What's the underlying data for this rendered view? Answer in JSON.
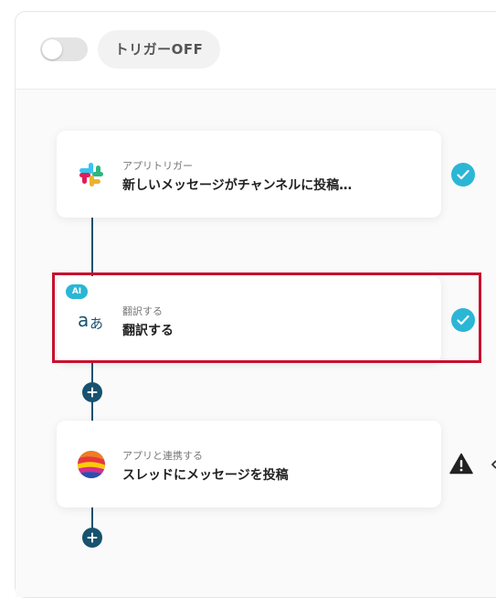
{
  "header": {
    "toggle_state": "off",
    "trigger_label": "トリガーOFF"
  },
  "flow": {
    "steps": [
      {
        "subtitle": "アプリトリガー",
        "title": "新しいメッセージがチャンネルに投稿…",
        "icon": "slack-icon",
        "status": "complete"
      },
      {
        "badge": "AI",
        "subtitle": "翻訳する",
        "title": "翻訳する",
        "icon": "translate-icon",
        "status": "complete",
        "highlighted": true
      },
      {
        "subtitle": "アプリと連携する",
        "title": "スレッドにメッセージを投稿",
        "icon": "app-integration-icon",
        "status": "warning"
      }
    ]
  },
  "colors": {
    "connector": "#17526e",
    "check": "#2bb6d6",
    "highlight_border": "#c8102e",
    "ai_badge": "#2bb6d6"
  }
}
